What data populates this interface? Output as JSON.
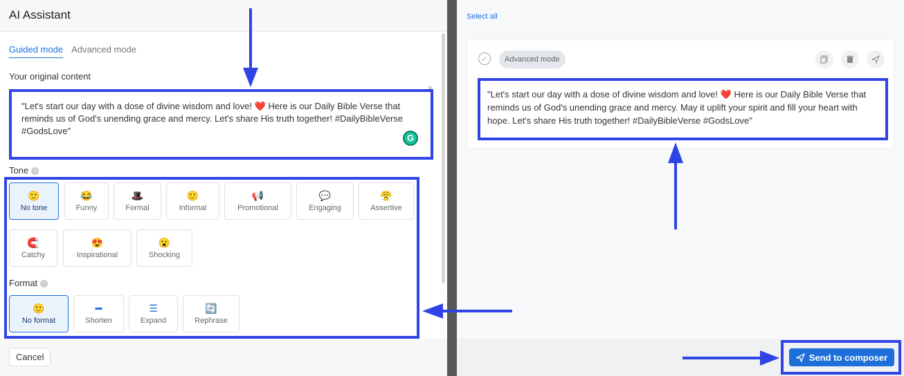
{
  "header": {
    "title": "AI Assistant"
  },
  "tabs": [
    {
      "label": "Guided mode",
      "active": true
    },
    {
      "label": "Advanced mode",
      "active": false
    }
  ],
  "original": {
    "label": "Your original content",
    "text": "\"Let's start our day with a dose of divine wisdom and love! ❤️ Here is our Daily Bible Verse that reminds us of God's unending grace and mercy. Let's share His truth together! #DailyBibleVerse #GodsLove\"",
    "close_glyph": "×"
  },
  "tone": {
    "label": "Tone",
    "options": [
      {
        "label": "No tone",
        "emoji": "🙂",
        "selected": true
      },
      {
        "label": "Funny",
        "emoji": "😂",
        "selected": false
      },
      {
        "label": "Formal",
        "emoji": "🎩",
        "selected": false
      },
      {
        "label": "Informal",
        "emoji": "🙂",
        "selected": false
      },
      {
        "label": "Promotional",
        "emoji": "📢",
        "selected": false
      },
      {
        "label": "Engaging",
        "emoji": "💬",
        "selected": false
      },
      {
        "label": "Assertive",
        "emoji": "😤",
        "selected": false
      },
      {
        "label": "Catchy",
        "emoji": "🧲",
        "selected": false
      },
      {
        "label": "Inspirational",
        "emoji": "😍",
        "selected": false
      },
      {
        "label": "Shocking",
        "emoji": "😮",
        "selected": false
      }
    ]
  },
  "format": {
    "label": "Format",
    "options": [
      {
        "label": "No format",
        "emoji": "🙂",
        "selected": true
      },
      {
        "label": "Shorten",
        "emoji": "▬",
        "selected": false
      },
      {
        "label": "Expand",
        "emoji": "☰",
        "selected": false
      },
      {
        "label": "Rephrase",
        "emoji": "🔄",
        "selected": false
      }
    ]
  },
  "footer": {
    "cancel_label": "Cancel"
  },
  "right": {
    "select_all_label": "Select all",
    "mode_pill": "Advanced mode",
    "result_text": "\"Let's start our day with a dose of divine wisdom and love! ❤️ Here is our Daily Bible Verse that reminds us of God's unending grace and mercy. May it uplift your spirit and fill your heart with hope. Let's share His truth together! #DailyBibleVerse #GodsLove\"",
    "send_label": "Send to composer"
  },
  "colors": {
    "accent": "#1e6fd9",
    "annotation": "#2f44e4"
  }
}
